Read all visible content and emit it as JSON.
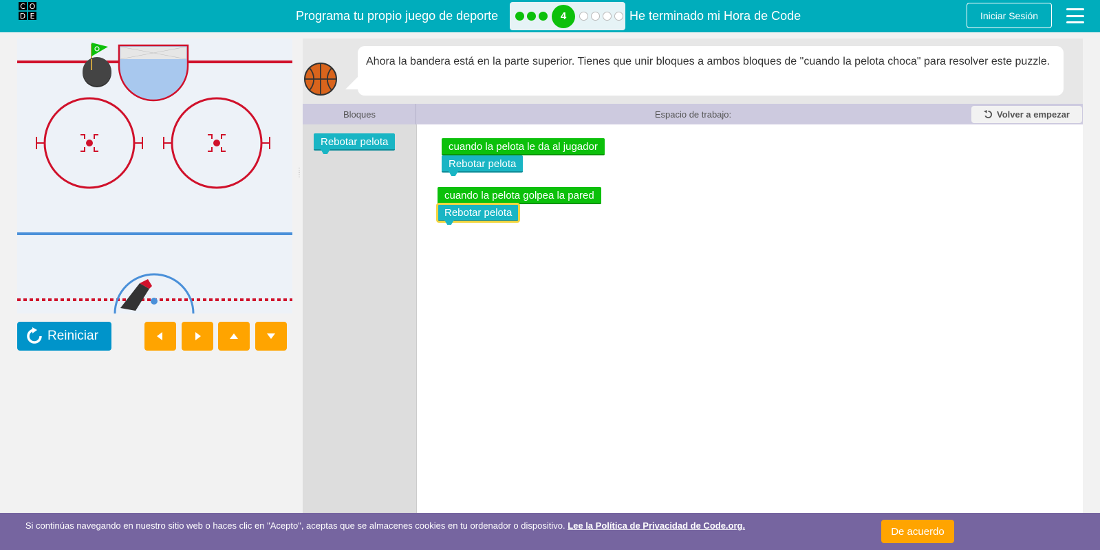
{
  "header": {
    "logo_letters": [
      "C",
      "O",
      "",
      "D",
      "E",
      ""
    ],
    "title": "Programa tu propio juego de deporte",
    "progress": {
      "completed": 3,
      "current_level": "4",
      "remaining": 4
    },
    "finish_link": "He terminado mi Hora de Code",
    "signin_label": "Iniciar Sesión",
    "menu_icon": "hamburger-icon",
    "accent_color": "#00adbc"
  },
  "game": {
    "reset_label": "Reiniciar",
    "reset_icon": "reset-icon",
    "arrow_buttons": [
      "left-arrow-icon",
      "right-arrow-icon",
      "up-arrow-icon",
      "down-arrow-icon"
    ]
  },
  "instructions": {
    "text": "Ahora la bandera está en la parte superior. Tienes que unir bloques a ambos bloques de \"cuando la pelota choca\" para resolver este puzzle.",
    "avatar_icon": "basketball-icon"
  },
  "workspace": {
    "toolbox_label": "Bloques",
    "workspace_label": "Espacio de trabajo:",
    "start_over_label": "Volver a empezar",
    "toolbox_blocks": [
      "Rebotar pelota"
    ],
    "blocks": {
      "event1": "cuando la pelota le da al jugador",
      "action1": "Rebotar pelota",
      "event2": "cuando la pelota golpea la pared",
      "action2": "Rebotar pelota"
    }
  },
  "cookie": {
    "text": "Si continúas navegando en nuestro sitio web o haces clic en \"Acepto\", aceptas que se almacenes cookies en tu ordenador o dispositivo.",
    "link_text": "Lee la Política de Privacidad de Code.org.",
    "accept_label": "De acuerdo"
  }
}
